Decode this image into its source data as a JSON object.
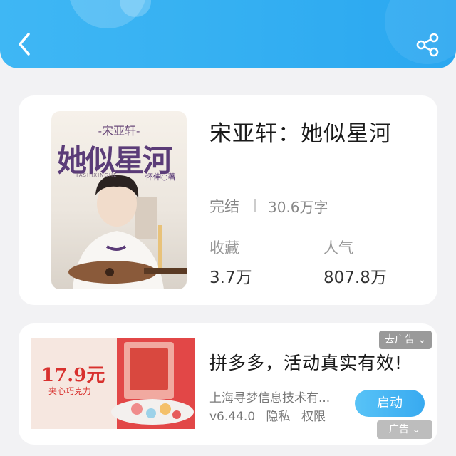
{
  "header": {
    "back_icon": "chevron-left-icon",
    "share_icon": "share-icon"
  },
  "book": {
    "title": "宋亚轩：她似星河",
    "status": "完结",
    "word_count": "30.6万字",
    "favorites_label": "收藏",
    "favorites_value": "3.7万",
    "popularity_label": "人气",
    "popularity_value": "807.8万",
    "cover": {
      "subtitle": "-宋亚轩-",
      "title": "她似星河",
      "pinyin": "TASHIXINGHE",
      "author": "怀伸○著"
    }
  },
  "ad": {
    "close_tag": "去广告 ⌄",
    "title": "拼多多，活动真实有效!",
    "company": "上海寻梦信息技术有...",
    "version": "v6.44.0",
    "privacy": "隐私",
    "permissions": "权限",
    "launch_label": "启动",
    "ad_label": "广告 ⌄",
    "image": {
      "price": "17.9元",
      "product": "夹心巧克力"
    },
    "colors": {
      "image_bg": "#e74a4a",
      "button": "#38aaf0"
    }
  },
  "colors": {
    "header": "#35b0f2",
    "background": "#f2f2f4"
  }
}
